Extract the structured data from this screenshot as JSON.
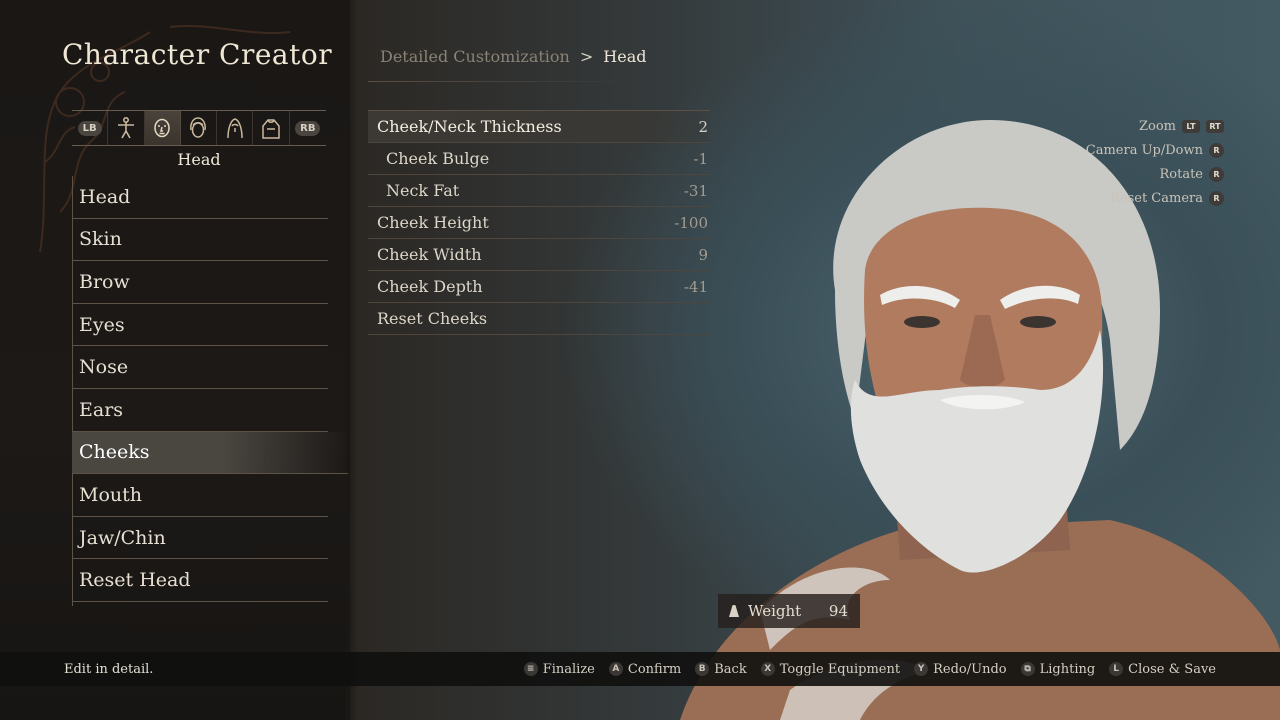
{
  "title": "Character Creator",
  "breadcrumb": {
    "parent": "Detailed Customization",
    "separator": ">",
    "current": "Head"
  },
  "category_tabs": {
    "left_bumper": "LB",
    "right_bumper": "RB",
    "icons": [
      "body-icon",
      "face-icon",
      "hair-icon",
      "makeup-icon",
      "clothing-icon"
    ],
    "active_index": 1,
    "active_label": "Head"
  },
  "menu": {
    "items": [
      "Head",
      "Skin",
      "Brow",
      "Eyes",
      "Nose",
      "Ears",
      "Cheeks",
      "Mouth",
      "Jaw/Chin",
      "Reset Head"
    ],
    "selected": "Cheeks"
  },
  "params": [
    {
      "label": "Cheek/Neck Thickness",
      "value": "2",
      "sub": false,
      "active": true
    },
    {
      "label": "Cheek Bulge",
      "value": "-1",
      "sub": true,
      "active": false
    },
    {
      "label": "Neck Fat",
      "value": "-31",
      "sub": true,
      "active": false
    },
    {
      "label": "Cheek Height",
      "value": "-100",
      "sub": false,
      "active": false
    },
    {
      "label": "Cheek Width",
      "value": "9",
      "sub": false,
      "active": false
    },
    {
      "label": "Cheek Depth",
      "value": "-41",
      "sub": false,
      "active": false
    },
    {
      "label": "Reset Cheeks",
      "value": "",
      "sub": false,
      "active": false
    }
  ],
  "camera": {
    "zoom": {
      "label": "Zoom",
      "keys": [
        "LT",
        "RT"
      ]
    },
    "updown": {
      "label": "Camera Up/Down",
      "key": "R"
    },
    "rotate": {
      "label": "Rotate",
      "key": "R"
    },
    "reset": {
      "label": "Reset Camera",
      "key": "R"
    }
  },
  "weight": {
    "label": "Weight",
    "value": "94"
  },
  "footer": {
    "hint": "Edit in detail.",
    "actions": [
      {
        "key": "≡",
        "label": "Finalize"
      },
      {
        "key": "A",
        "label": "Confirm"
      },
      {
        "key": "B",
        "label": "Back"
      },
      {
        "key": "X",
        "label": "Toggle Equipment"
      },
      {
        "key": "Y",
        "label": "Redo/Undo"
      },
      {
        "key": "⧉",
        "label": "Lighting"
      },
      {
        "key": "L",
        "label": "Close & Save"
      }
    ]
  }
}
